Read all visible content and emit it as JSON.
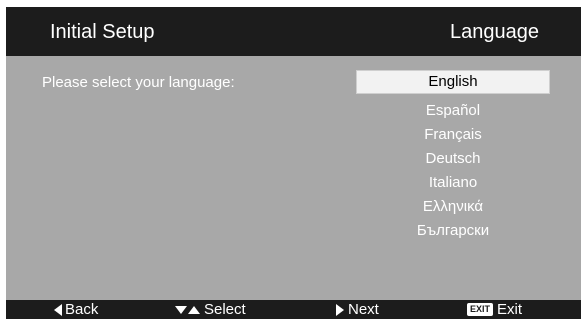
{
  "header": {
    "title": "Initial Setup",
    "section": "Language"
  },
  "prompt": "Please select your language:",
  "languages": {
    "selected": "English",
    "options": [
      "Español",
      "Français",
      "Deutsch",
      "Italiano",
      "Ελληνικά",
      "Български"
    ]
  },
  "footer": {
    "back": "Back",
    "select": "Select",
    "next": "Next",
    "exit_badge": "EXIT",
    "exit": "Exit"
  },
  "colors": {
    "panel": "#a8a8a8",
    "bar": "#1c1c1c",
    "highlight": "#f2f2f2"
  }
}
